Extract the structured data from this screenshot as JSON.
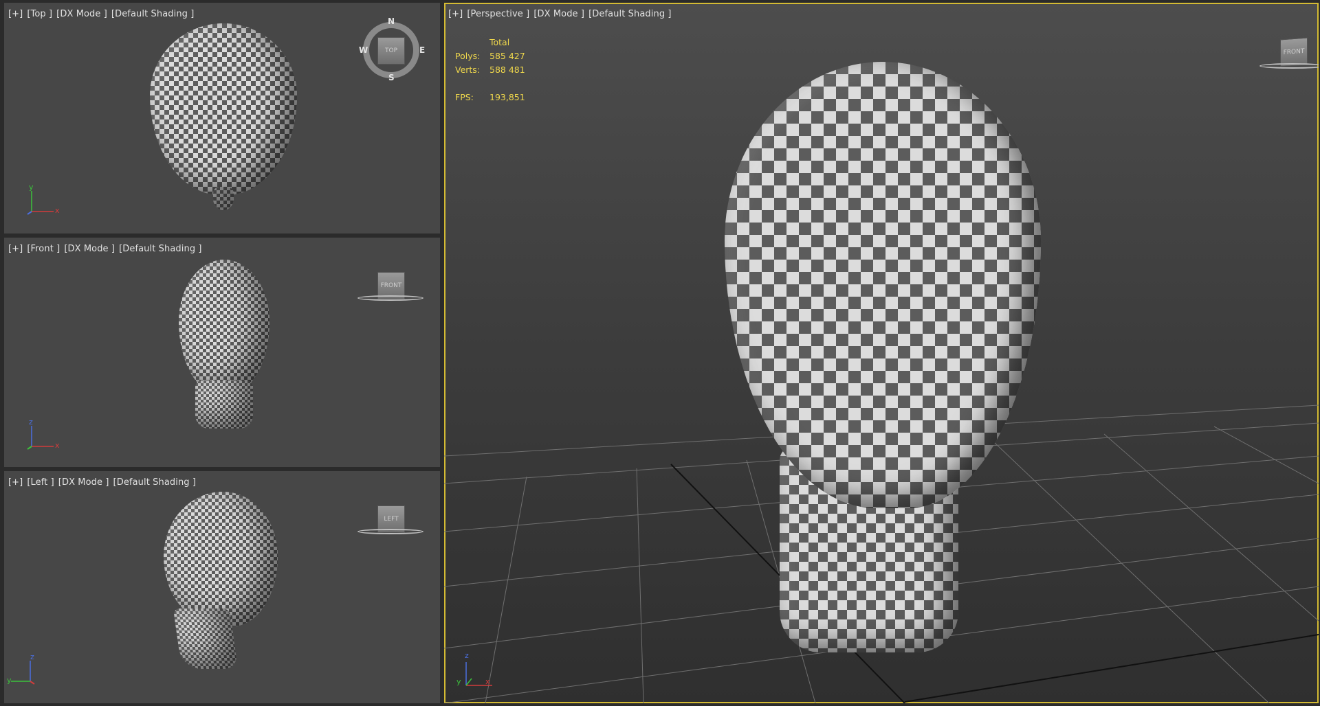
{
  "viewports": {
    "top": {
      "plus": "[+]",
      "view": "[Top ]",
      "mode": "[DX Mode ]",
      "shading": "[Default Shading ]",
      "navcube": "TOP",
      "compass": {
        "n": "N",
        "e": "E",
        "s": "S",
        "w": "W"
      },
      "axis": {
        "v": "y",
        "h": "x"
      }
    },
    "front": {
      "plus": "[+]",
      "view": "[Front ]",
      "mode": "[DX Mode ]",
      "shading": "[Default Shading ]",
      "navcube": "FRONT",
      "axis": {
        "v": "z",
        "h": "x"
      }
    },
    "left": {
      "plus": "[+]",
      "view": "[Left ]",
      "mode": "[DX Mode ]",
      "shading": "[Default Shading ]",
      "navcube": "LEFT",
      "axis": {
        "v": "z",
        "h": "y"
      }
    },
    "perspective": {
      "plus": "[+]",
      "view": "[Perspective ]",
      "mode": "[DX Mode ]",
      "shading": "[Default Shading ]",
      "navcube": "FRONT",
      "axis": {
        "v": "z",
        "h": "x",
        "d": "y"
      }
    }
  },
  "stats": {
    "header": "Total",
    "polys_label": "Polys:",
    "polys": "585 427",
    "verts_label": "Verts:",
    "verts": "588 481",
    "fps_label": "FPS:",
    "fps": "193,851"
  },
  "colors": {
    "active_border": "#d4bb33",
    "stats_text": "#f0d84c",
    "axis_x": "#d23c3c",
    "axis_y": "#3cc23c",
    "axis_z": "#4b6fe0"
  }
}
